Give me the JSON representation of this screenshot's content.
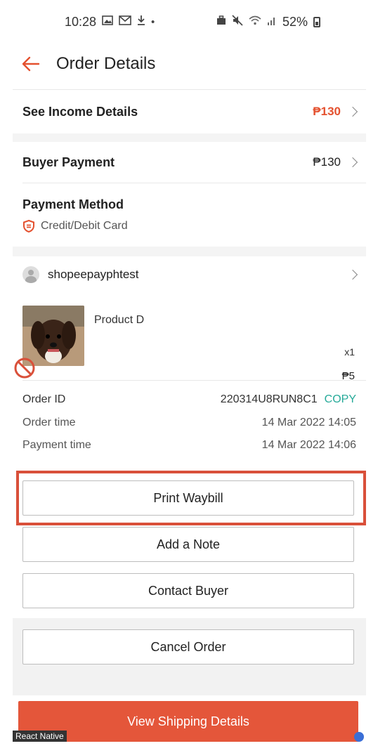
{
  "status_bar": {
    "time": "10:28",
    "battery": "52%"
  },
  "header": {
    "title": "Order Details"
  },
  "income": {
    "label": "See Income Details",
    "amount": "₱130"
  },
  "buyer_payment": {
    "label": "Buyer Payment",
    "amount": "₱130"
  },
  "payment_method": {
    "label": "Payment Method",
    "value": "Credit/Debit Card"
  },
  "buyer": {
    "username": "shopeepayphtest"
  },
  "product": {
    "name": "Product D",
    "quantity": "x1",
    "price": "₱5"
  },
  "order_info": {
    "order_id_label": "Order ID",
    "order_id": "220314U8RUN8C1",
    "copy_label": "COPY",
    "order_time_label": "Order time",
    "order_time": "14 Mar 2022 14:05",
    "payment_time_label": "Payment time",
    "payment_time": "14 Mar 2022 14:06"
  },
  "actions": {
    "print_waybill": "Print Waybill",
    "add_note": "Add a Note",
    "contact_buyer": "Contact Buyer",
    "cancel_order": "Cancel Order"
  },
  "bottom": {
    "view_shipping": "View Shipping Details",
    "rn_label": "React Native"
  },
  "colors": {
    "accent": "#e4512f",
    "copy": "#26aa99",
    "highlight_box": "#d9503a"
  }
}
